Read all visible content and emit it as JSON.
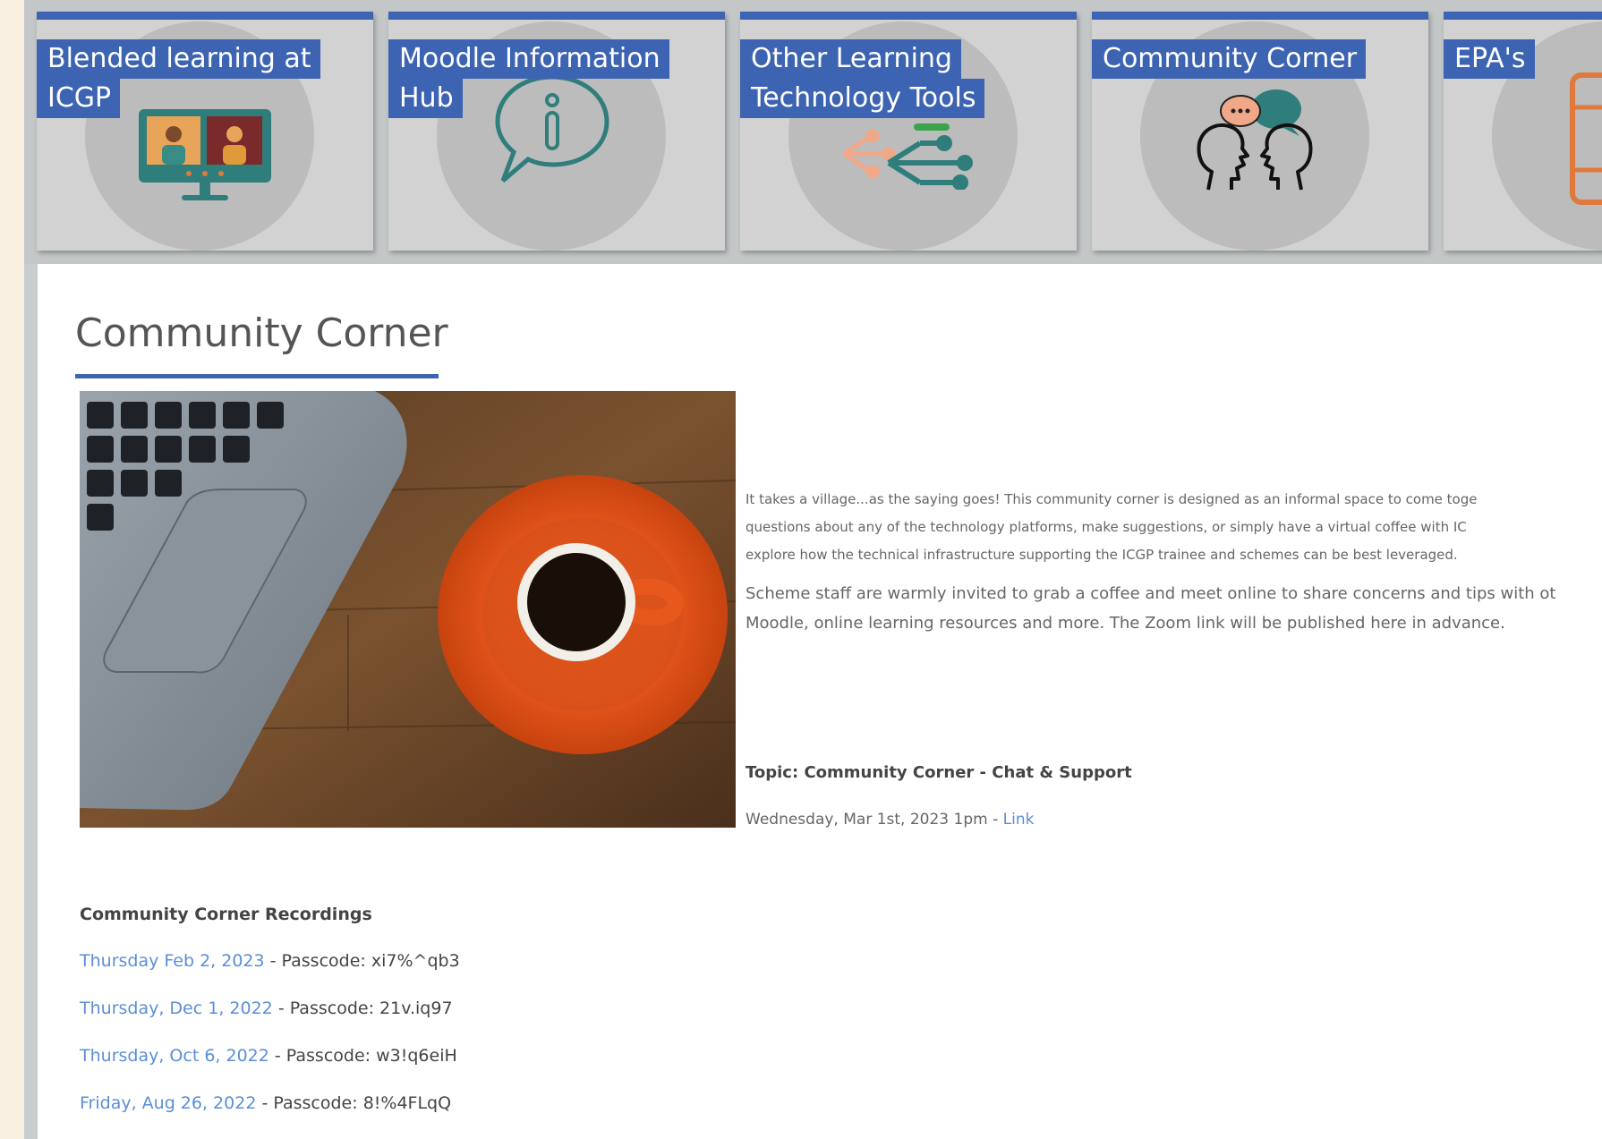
{
  "tiles": [
    {
      "line1": "Blended learning at",
      "line2": "ICGP",
      "icon": "video-conference-icon"
    },
    {
      "line1": "Moodle Information",
      "line2": "Hub",
      "icon": "info-speech-bubble-icon"
    },
    {
      "line1": "Other Learning",
      "line2": "Technology Tools",
      "icon": "share-network-icon"
    },
    {
      "line1": "Community Corner",
      "line2": "",
      "icon": "conversation-heads-icon"
    },
    {
      "line1": "EPA's",
      "line2": "",
      "icon": "document-icon"
    }
  ],
  "page": {
    "title": "Community Corner",
    "hero_image": "laptop-and-coffee-photo",
    "intro": {
      "line1": "It takes a village...as the saying goes! This community corner is designed as an informal space to come toge",
      "line2": "questions about any of the technology platforms, make suggestions, or simply have a virtual coffee with IC",
      "line3": "explore how the technical infrastructure supporting the ICGP trainee and schemes can be best leveraged.",
      "line4": "Scheme staff are warmly invited to grab a coffee and meet online to share concerns and tips with ot",
      "line5": "Moodle, online learning resources and more. The Zoom link will be published here in advance."
    },
    "topic": "Topic: Community Corner - Chat & Support",
    "session": {
      "date": "Wednesday, Mar 1st, 2023 1pm",
      "separator": "-",
      "link_label": "Link"
    }
  },
  "recordings": {
    "heading": "Community Corner Recordings",
    "items": [
      {
        "date": "Thursday Feb 2, 2023",
        "passcode_label": "- Passcode:",
        "passcode": "xi7%^qb3"
      },
      {
        "date": "Thursday, Dec 1, 2022",
        "passcode_label": "- Passcode:",
        "passcode": "21v.iq97"
      },
      {
        "date": "Thursday, Oct 6, 2022",
        "passcode_label": "- Passcode:",
        "passcode": "w3!q6eiH"
      },
      {
        "date": "Friday, Aug 26, 2022",
        "passcode_label": "- Passcode:",
        "passcode": "8!%4FLqQ"
      }
    ]
  },
  "colors": {
    "accent": "#3d64b3",
    "link": "#5b8ed6",
    "teal_icon": "#2f7e7b",
    "orange_icon": "#e07a3c"
  }
}
